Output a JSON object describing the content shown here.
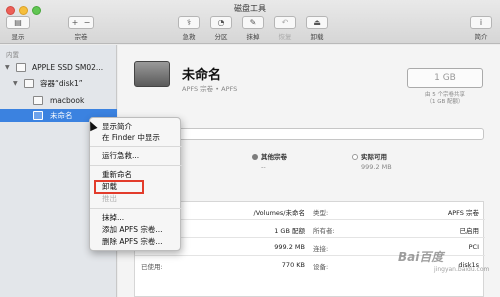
{
  "window": {
    "title": "磁盘工具"
  },
  "toolbar": {
    "display": "显示",
    "volume": "宗卷",
    "firstaid": "急救",
    "partition": "分区",
    "erase": "抹掉",
    "restore": "恢复",
    "unmount": "卸载",
    "info": "简介",
    "sidebar_icon": "▤",
    "plus": "+",
    "minus": "−",
    "info_icon": "i"
  },
  "sidebar": {
    "section": "内置",
    "items": [
      {
        "label": "APPLE SSD SM02..."
      },
      {
        "label": "容器“disk1”"
      },
      {
        "label": "macbook"
      },
      {
        "label": "未命名"
      }
    ]
  },
  "volume": {
    "name": "未命名",
    "subtitle": "APFS 宗卷 • APFS",
    "capacity": "1 GB",
    "capacity_sub_line1": "由 5 个宗卷共享",
    "capacity_sub_line2": "（1 GB 配额）"
  },
  "legend": {
    "other_label": "其他宗卷",
    "other_value": "--",
    "free_label": "实际可用",
    "free_value": "999.2 MB",
    "other_color": "#7d7d7d",
    "free_color": "#ffffff"
  },
  "info_table": {
    "rows": [
      {
        "k1": "",
        "v1": "/Volumes/未命名",
        "k2": "类型:",
        "v2": "APFS 宗卷"
      },
      {
        "k1": "",
        "v1": "1 GB 配额",
        "k2": "所有者:",
        "v2": "已启用"
      },
      {
        "k1": "",
        "v1": "999.2 MB",
        "k2": "连接:",
        "v2": "PCI"
      },
      {
        "k1": "已使用:",
        "v1": "770 KB",
        "k2": "设备:",
        "v2": "disk1s"
      }
    ]
  },
  "context_menu": {
    "items": [
      "显示简介",
      "在 Finder 中显示",
      "运行急救...",
      "重新命名",
      "卸载",
      "推出",
      "抹掉...",
      "添加 APFS 宗卷...",
      "删除 APFS 宗卷..."
    ]
  },
  "watermark": {
    "main": "Bai百度",
    "sub": "jingyan.baidu.com"
  }
}
